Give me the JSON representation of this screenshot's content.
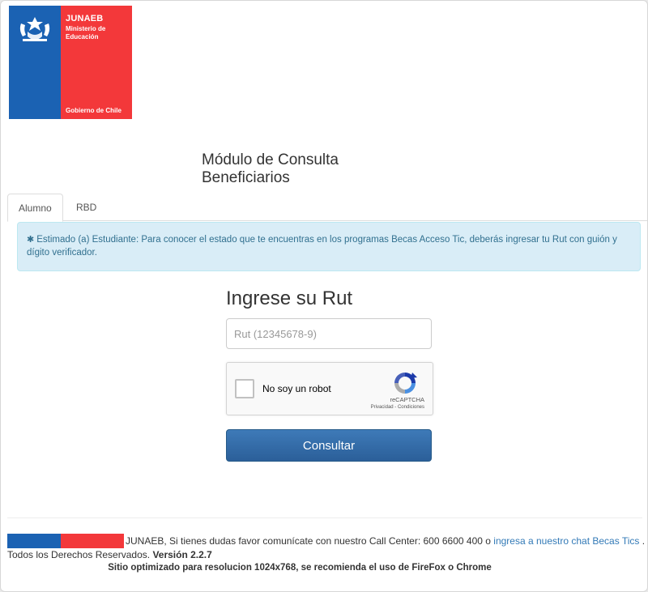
{
  "logo": {
    "org": "JUNAEB",
    "ministry": "Ministerio de Educación",
    "government": "Gobierno de Chile",
    "colors": {
      "blue": "#1b62b3",
      "red": "#f3383a"
    }
  },
  "title": {
    "line1": "Módulo de Consulta",
    "line2": "Beneficiarios"
  },
  "tabs": [
    {
      "label": "Alumno",
      "active": true
    },
    {
      "label": "RBD",
      "active": false
    }
  ],
  "alert": {
    "icon": "asterisk-icon",
    "text": "Estimado (a) Estudiante: Para conocer el estado que te encuentras en los programas Becas Acceso Tic, deberás ingresar tu Rut con guión y dígito verificador."
  },
  "form": {
    "heading": "Ingrese su Rut",
    "rut_placeholder": "Rut (12345678-9)",
    "captcha": {
      "label": "No soy un robot",
      "brand": "reCAPTCHA",
      "terms": "Privacidad - Condiciones"
    },
    "submit_label": "Consultar"
  },
  "footer": {
    "contact_text": "JUNAEB, Si tienes dudas favor comunícate con nuestro Call Center: 600 6600 400 o",
    "chat_link": "ingresa a nuestro chat Becas Tics",
    "period": ".",
    "rights": "Todos los Derechos Reservados.",
    "version": "Versión 2.2.7",
    "resolution_note": "Sitio optimizado para resolucion 1024x768, se recomienda el uso de FireFox o Chrome"
  }
}
